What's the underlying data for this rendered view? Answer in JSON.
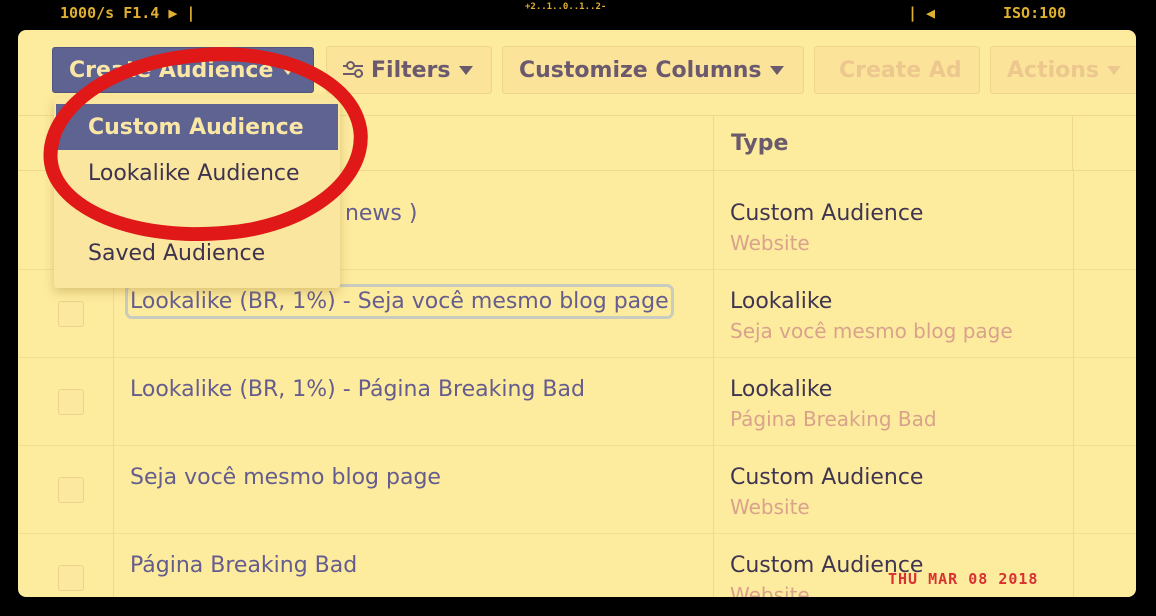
{
  "hud": {
    "shutter": "1000/s  F1.4  ▶ |",
    "meter": "+2..1..0..1..2-",
    "ticks": "| ◀",
    "iso": "ISO:100",
    "date_stamp": "THU MAR 08 2018"
  },
  "toolbar": {
    "create_audience": "Create Audience",
    "filters": "Filters",
    "customize_columns": "Customize Columns",
    "create_ad": "Create Ad",
    "actions": "Actions"
  },
  "menu": {
    "items": [
      "Custom Audience",
      "Lookalike Audience",
      "Saved Audience"
    ]
  },
  "table": {
    "type_header": "Type",
    "rows": [
      {
        "name": "d news )",
        "type": "Custom Audience",
        "sub": "Website"
      },
      {
        "name": "Lookalike (BR, 1%) - Seja você mesmo blog page",
        "type": "Lookalike",
        "sub": "Seja você mesmo blog page"
      },
      {
        "name": "Lookalike (BR, 1%) - Página Breaking Bad",
        "type": "Lookalike",
        "sub": "Página Breaking Bad"
      },
      {
        "name": "Seja você mesmo blog page",
        "type": "Custom Audience",
        "sub": "Website"
      },
      {
        "name": "Página Breaking Bad",
        "type": "Custom Audience",
        "sub": "Website"
      }
    ]
  },
  "colors": {
    "accent": "#5e6391",
    "annotation": "#e01818",
    "background": "#fdeb9e"
  }
}
